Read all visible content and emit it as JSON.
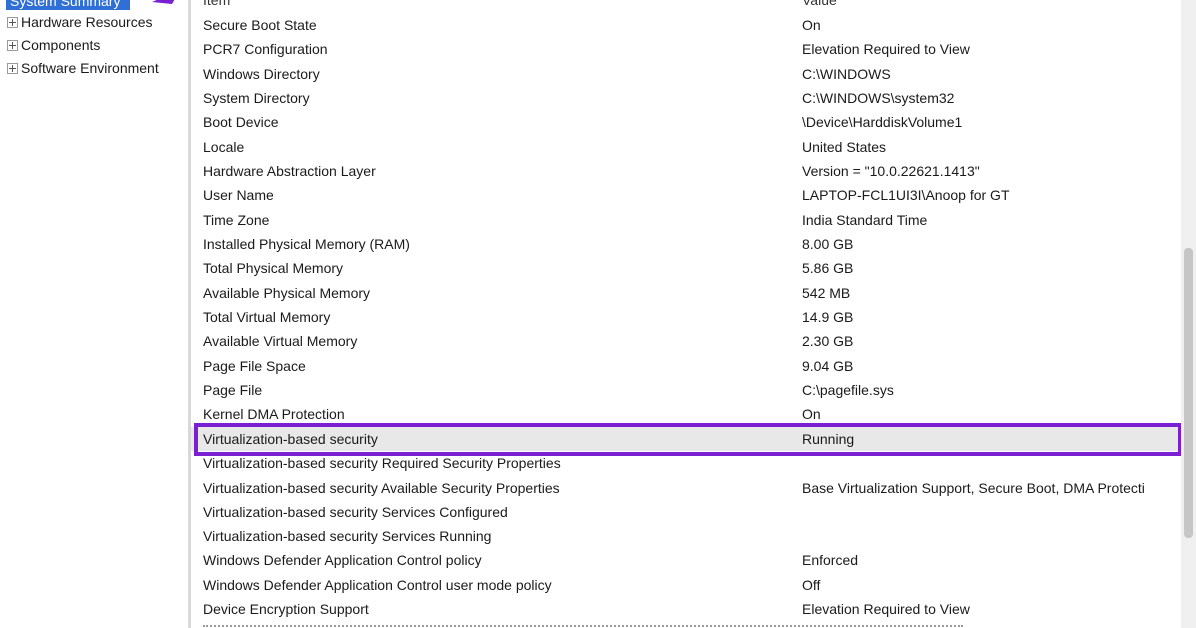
{
  "tree": {
    "selected_label": "System Summary",
    "items": [
      {
        "label": "Hardware Resources"
      },
      {
        "label": "Components"
      },
      {
        "label": "Software Environment"
      }
    ]
  },
  "list": {
    "columns": {
      "item": "Item",
      "value": "Value"
    },
    "rows": [
      {
        "item": "Secure Boot State",
        "value": "On"
      },
      {
        "item": "PCR7 Configuration",
        "value": "Elevation Required to View"
      },
      {
        "item": "Windows Directory",
        "value": "C:\\WINDOWS"
      },
      {
        "item": "System Directory",
        "value": "C:\\WINDOWS\\system32"
      },
      {
        "item": "Boot Device",
        "value": "\\Device\\HarddiskVolume1"
      },
      {
        "item": "Locale",
        "value": "United States"
      },
      {
        "item": "Hardware Abstraction Layer",
        "value": "Version = \"10.0.22621.1413\""
      },
      {
        "item": "User Name",
        "value": "LAPTOP-FCL1UI3I\\Anoop for GT"
      },
      {
        "item": "Time Zone",
        "value": "India Standard Time"
      },
      {
        "item": "Installed Physical Memory (RAM)",
        "value": "8.00 GB"
      },
      {
        "item": "Total Physical Memory",
        "value": "5.86 GB"
      },
      {
        "item": "Available Physical Memory",
        "value": "542 MB"
      },
      {
        "item": "Total Virtual Memory",
        "value": "14.9 GB"
      },
      {
        "item": "Available Virtual Memory",
        "value": "2.30 GB"
      },
      {
        "item": "Page File Space",
        "value": "9.04 GB"
      },
      {
        "item": "Page File",
        "value": "C:\\pagefile.sys"
      },
      {
        "item": "Kernel DMA Protection",
        "value": "On"
      },
      {
        "item": "Virtualization-based security",
        "value": "Running"
      },
      {
        "item": "Virtualization-based security Required Security Properties",
        "value": ""
      },
      {
        "item": "Virtualization-based security Available Security Properties",
        "value": "Base Virtualization Support, Secure Boot, DMA Protecti"
      },
      {
        "item": "Virtualization-based security Services Configured",
        "value": ""
      },
      {
        "item": "Virtualization-based security Services Running",
        "value": ""
      },
      {
        "item": "Windows Defender Application Control policy",
        "value": "Enforced"
      },
      {
        "item": "Windows Defender Application Control user mode policy",
        "value": "Off"
      },
      {
        "item": "Device Encryption Support",
        "value": "Elevation Required to View"
      }
    ],
    "highlighted_row_index": 17
  },
  "colors": {
    "highlight_border": "#7a1fd1",
    "selection_bg": "#2f6fd6",
    "annotation_arrow": "#7a1fd1"
  }
}
